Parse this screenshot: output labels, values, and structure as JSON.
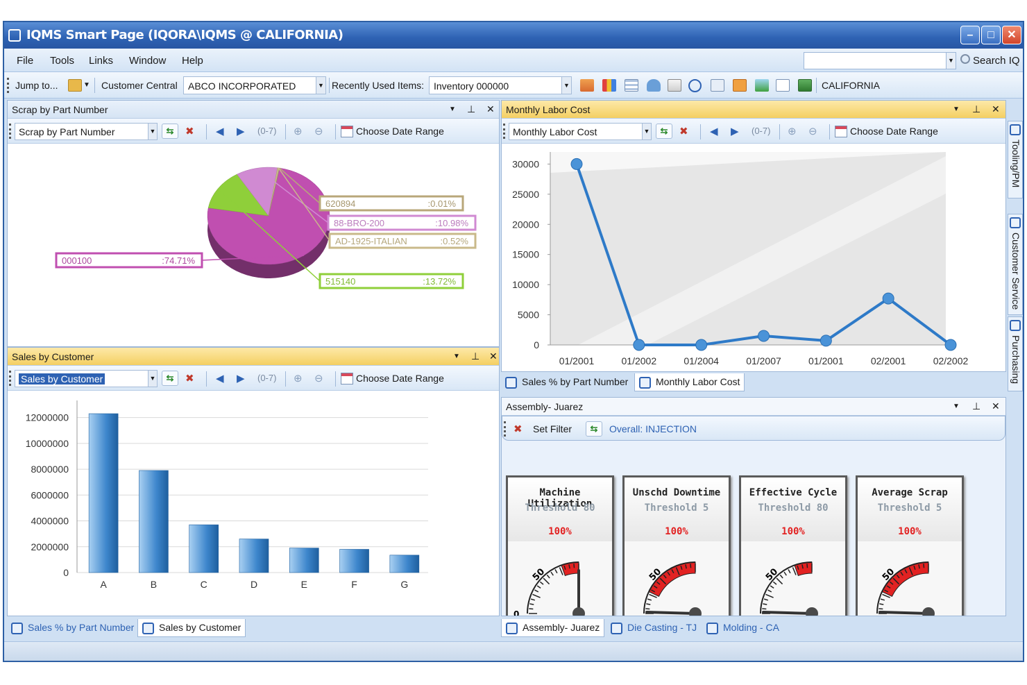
{
  "window": {
    "title": "IQMS Smart Page (IQORA\\IQMS @ CALIFORNIA)"
  },
  "menu": {
    "items": [
      "File",
      "Tools",
      "Links",
      "Window",
      "Help"
    ],
    "search_label": "Search IQ"
  },
  "toolbar": {
    "jump_to": "Jump to...",
    "customer_central_label": "Customer Central",
    "customer_value": "ABCO INCORPORATED",
    "recent_label": "Recently Used Items:",
    "recent_value": "Inventory 000000",
    "site": "CALIFORNIA"
  },
  "common": {
    "date_range": "Choose Date Range",
    "range": "(0-7)"
  },
  "scrap_panel": {
    "title": "Scrap by Part Number",
    "combo": "Scrap by Part Number",
    "chart_data": {
      "type": "pie",
      "slices": [
        {
          "label": "000100",
          "pct": ":74.71%",
          "value": 74.71,
          "color": "#c04fb0"
        },
        {
          "label": "515140",
          "pct": ":13.72%",
          "value": 13.72,
          "color": "#8fcf3a"
        },
        {
          "label": "88-BRO-200",
          "pct": ":10.98%",
          "value": 10.98,
          "color": "#d08ad2"
        },
        {
          "label": "AD-1925-ITALIAN",
          "pct": ":0.52%",
          "value": 0.52,
          "color": "#c9b98a"
        },
        {
          "label": "620894",
          "pct": ":0.01%",
          "value": 0.01,
          "color": "#b8a77a"
        }
      ]
    }
  },
  "labor_panel": {
    "title": "Monthly Labor Cost",
    "combo": "Monthly Labor Cost",
    "chart_data": {
      "type": "line",
      "x": [
        "01/2001",
        "01/2002",
        "01/2004",
        "01/2007",
        "01/2001",
        "02/2001",
        "02/2002"
      ],
      "values": [
        30000,
        0,
        0,
        1500,
        700,
        7700,
        0
      ],
      "yticks": [
        0,
        5000,
        10000,
        15000,
        20000,
        25000,
        30000
      ],
      "ylim": [
        0,
        32000
      ],
      "color": "#2e7ac8"
    }
  },
  "sales_panel": {
    "title": "Sales by Customer",
    "combo": "Sales by Customer",
    "chart_data": {
      "type": "bar",
      "categories": [
        "A",
        "B",
        "C",
        "D",
        "E",
        "F",
        "G"
      ],
      "values": [
        12300000,
        7900000,
        3700000,
        2600000,
        1900000,
        1800000,
        1350000
      ],
      "yticks": [
        0,
        2000000,
        4000000,
        6000000,
        8000000,
        10000000,
        12000000
      ],
      "ylim": [
        0,
        13000000
      ],
      "color": "#3d86cc"
    }
  },
  "tabs_left": [
    "Sales % by Part Number",
    "Sales by Customer"
  ],
  "tabs_right_top": [
    "Sales % by Part Number",
    "Monthly Labor Cost"
  ],
  "assembly_panel": {
    "title": "Assembly- Juarez",
    "set_filter": "Set Filter",
    "overall": "Overall: INJECTION",
    "gauges": [
      {
        "title": "Machine Utilization",
        "threshold": "Threshold 80",
        "pct": "100%",
        "tick": "50",
        "zero": "0",
        "value": 100
      },
      {
        "title": "Unschd Downtime",
        "threshold": "Threshold 5",
        "pct": "100%",
        "tick": "50",
        "value": 100
      },
      {
        "title": "Effective Cycle",
        "threshold": "Threshold 80",
        "pct": "100%",
        "tick": "50",
        "value": 100
      },
      {
        "title": "Average Scrap",
        "threshold": "Threshold 5",
        "pct": "100%",
        "tick": "50",
        "value": 100
      }
    ]
  },
  "tabs_right_bottom": [
    "Assembly- Juarez",
    "Die Casting - TJ",
    "Molding - CA"
  ],
  "side_tabs": [
    "Tooling/PM",
    "Customer Service",
    "Purchasing"
  ],
  "colors": {
    "accent": "#2e62b3",
    "active_title": "#f4cf62",
    "gauge_red": "#e22222"
  }
}
